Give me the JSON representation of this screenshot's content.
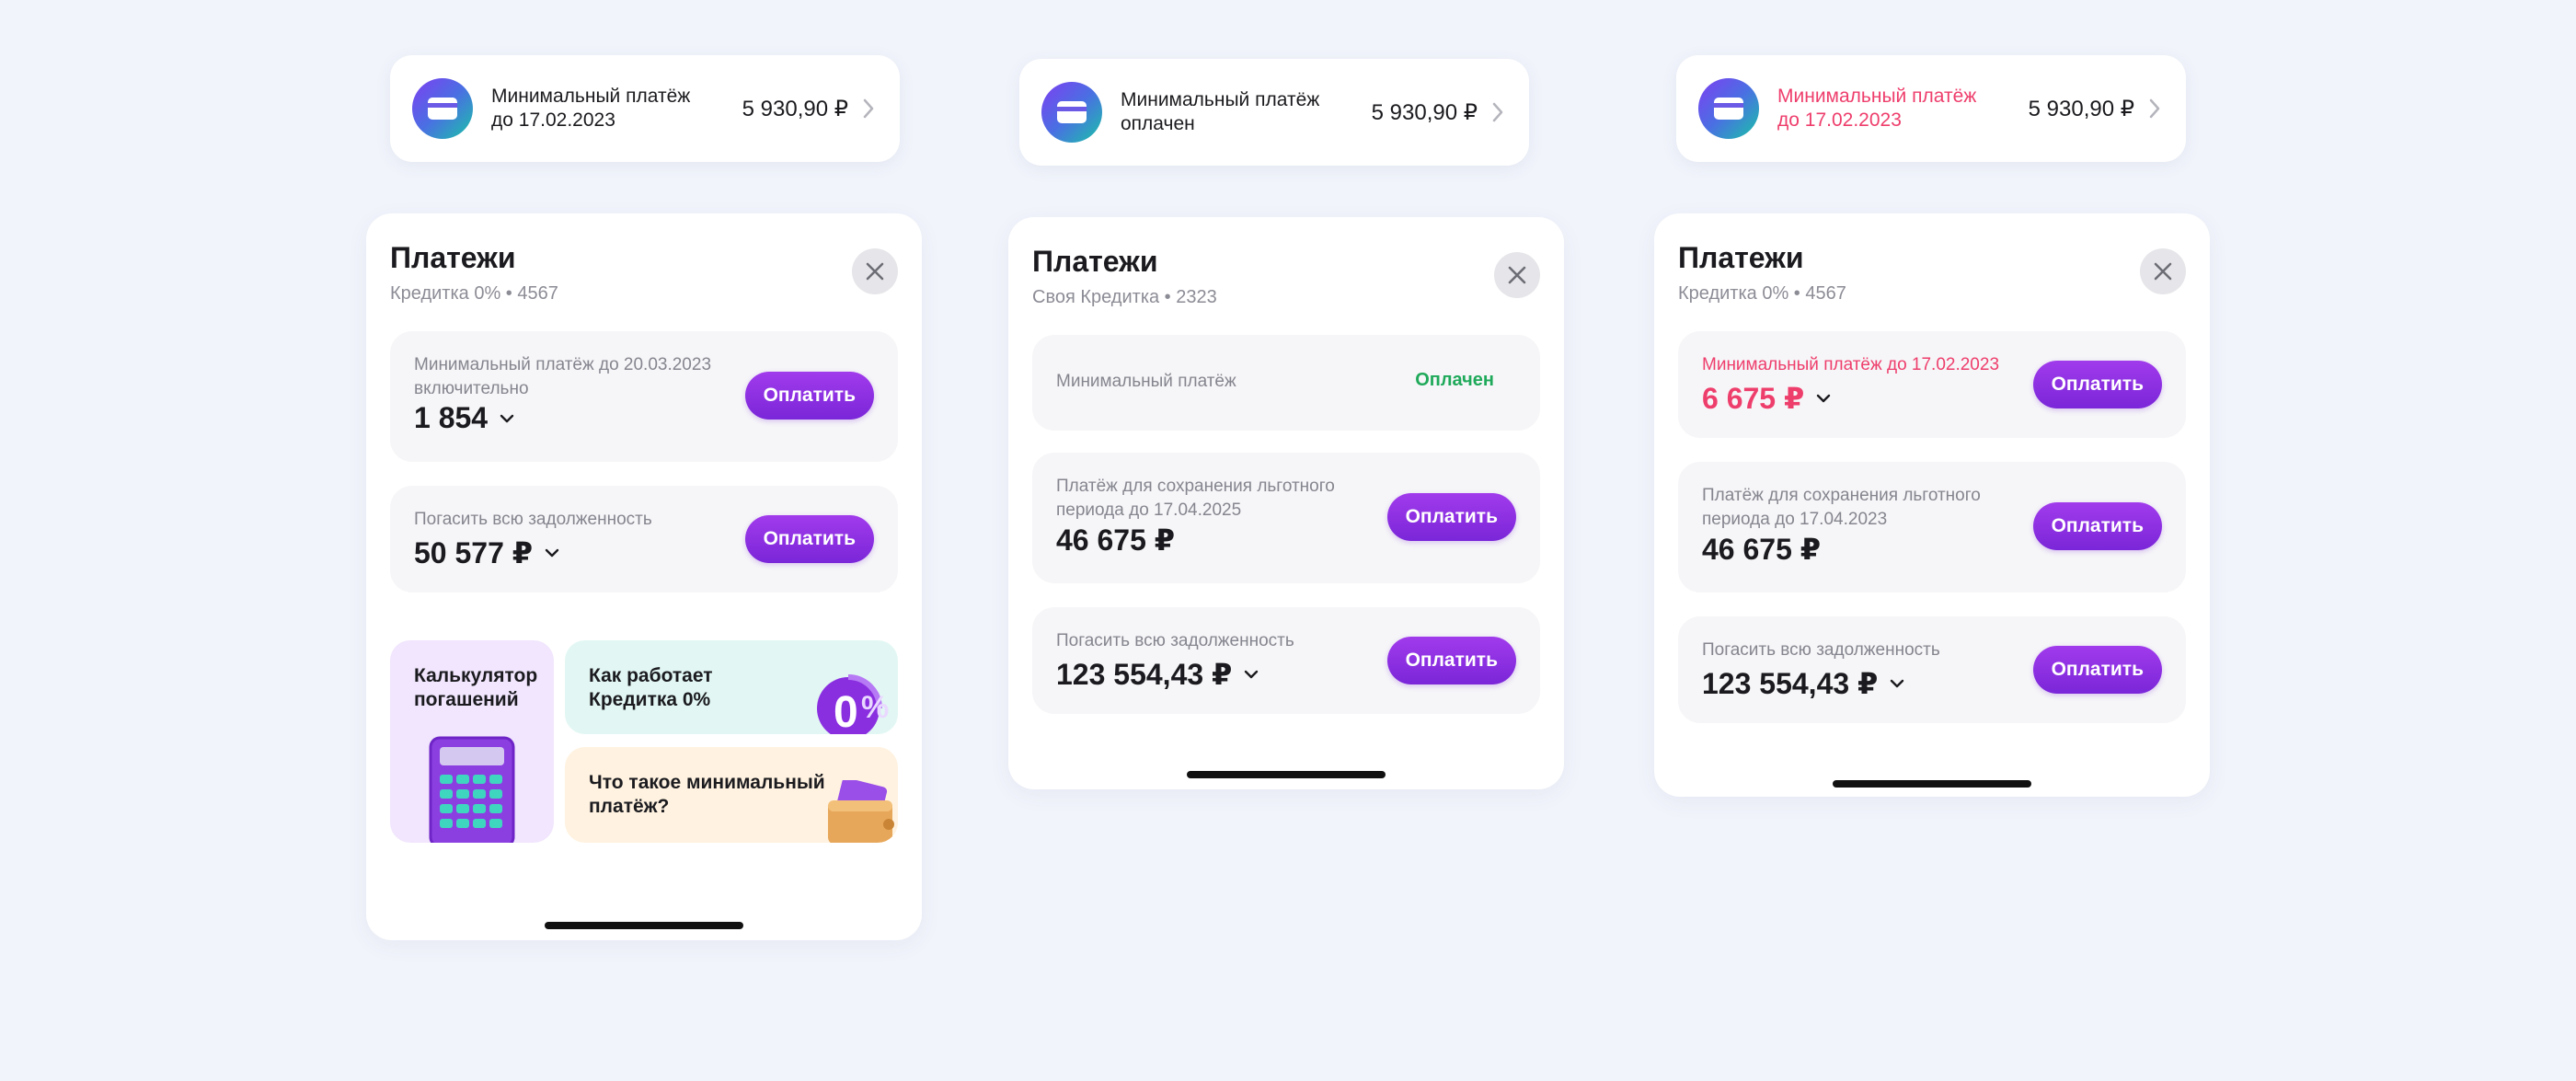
{
  "currency": "₽",
  "colors": {
    "background": "#f1f4fb",
    "accent_purple": "#8a2fe0",
    "alert_red": "#ee3e6c",
    "paid_green": "#1fa95a",
    "muted_text": "#85858f"
  },
  "icons": {
    "card": "credit-card-icon",
    "chevron_right": "chevron-right-icon",
    "chevron_down": "chevron-down-icon",
    "close": "close-icon",
    "calculator": "calculator-illustration",
    "percent": "percent-illustration",
    "wallet": "wallet-illustration"
  },
  "top_cards": [
    {
      "text": "Минимальный платёж до 17.02.2023",
      "amount": "5 930,90 ₽",
      "state": "normal"
    },
    {
      "text": "Минимальный платёж оплачен",
      "amount": "5 930,90 ₽",
      "state": "paid"
    },
    {
      "text": "Минимальный платёж до 17.02.2023",
      "amount": "5 930,90 ₽",
      "state": "overdue"
    }
  ],
  "panels": [
    {
      "title": "Платежи",
      "subtitle": "Кредитка 0% • 4567",
      "payments": [
        {
          "label": "Минимальный платёж до 20.03.2023 включительно",
          "amount": "1 854",
          "has_dropdown": true,
          "button": "Оплатить"
        },
        {
          "label": "Погасить всю задолженность",
          "amount": "50 577 ₽",
          "has_dropdown": true,
          "button": "Оплатить"
        }
      ],
      "tiles": [
        {
          "text": "Калькулятор погашений",
          "bg": "#f1e6fd"
        },
        {
          "text": "Как работает Кредитка 0%",
          "bg": "#e2f7f3"
        },
        {
          "text": "Что такое минимальный платёж?",
          "bg": "#fff2e0"
        }
      ]
    },
    {
      "title": "Платежи",
      "subtitle": "Своя Кредитка • 2323",
      "payments": [
        {
          "label": "Минимальный платёж",
          "status": "Оплачен"
        },
        {
          "label": "Платёж для сохранения льготного периода до 17.04.2025",
          "amount": "46 675 ₽",
          "has_dropdown": false,
          "button": "Оплатить"
        },
        {
          "label": "Погасить всю задолженность",
          "amount": "123 554,43 ₽",
          "has_dropdown": true,
          "button": "Оплатить"
        }
      ]
    },
    {
      "title": "Платежи",
      "subtitle": "Кредитка 0% • 4567",
      "payments": [
        {
          "label": "Минимальный платёж до 17.02.2023",
          "amount": "6 675 ₽",
          "has_dropdown": true,
          "button": "Оплатить",
          "state": "overdue"
        },
        {
          "label": "Платёж для сохранения льготного периода до 17.04.2023",
          "amount": "46 675 ₽",
          "has_dropdown": false,
          "button": "Оплатить"
        },
        {
          "label": "Погасить всю задолженность",
          "amount": "123 554,43 ₽",
          "has_dropdown": true,
          "button": "Оплатить"
        }
      ]
    }
  ]
}
